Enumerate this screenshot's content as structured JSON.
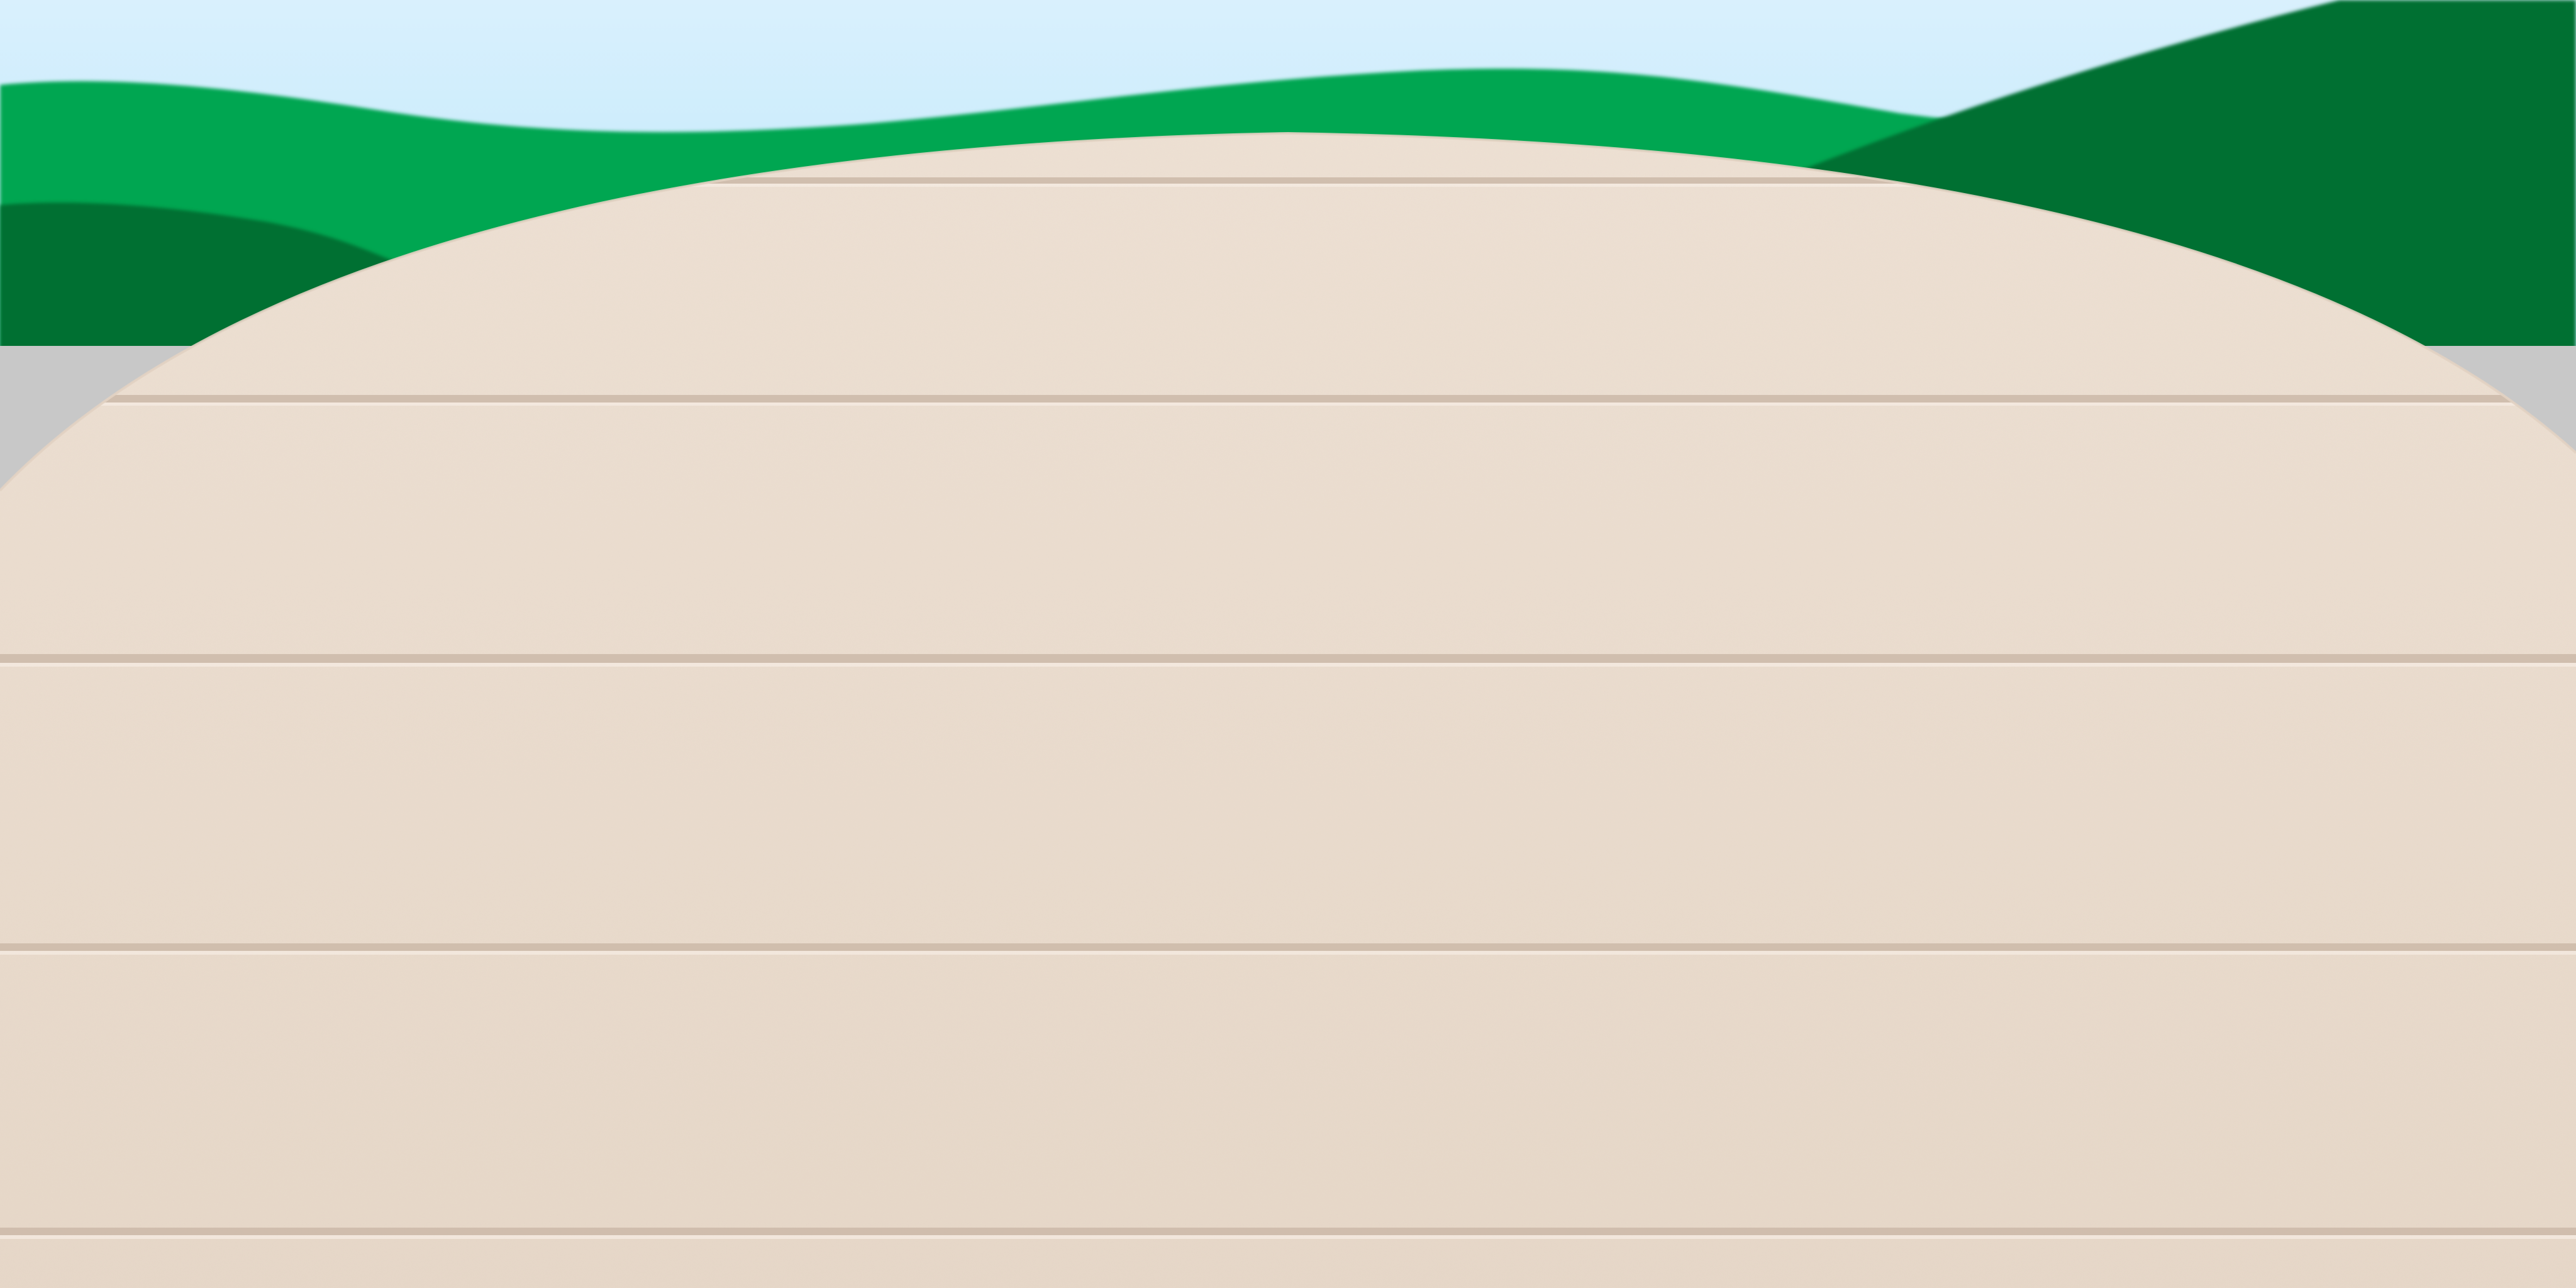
{
  "scene": {
    "kind": "background-backdrop",
    "colors": {
      "sky_top": "#d9f0fd",
      "sky_bottom": "#b9e7fb",
      "far_hills": "#00a651",
      "near_hills": "#007032",
      "ground_strip": "#c8c8c8",
      "table_surface": "#efe2d5",
      "table_surface_shade": "#e7d8c9",
      "plank_groove": "#cbb8a8",
      "plank_highlight": "#f6ede4"
    }
  }
}
